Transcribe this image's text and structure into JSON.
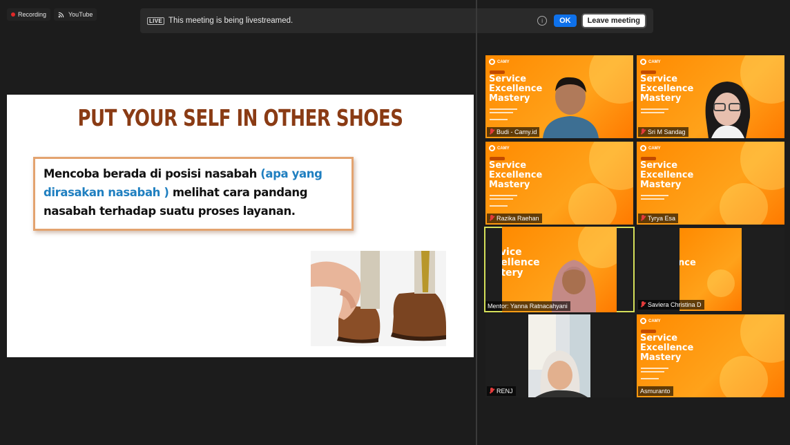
{
  "topbar": {
    "recording_label": "Recording",
    "youtube_label": "YouTube",
    "live_tag": "LIVE",
    "live_message": "This meeting is being livestreamed.",
    "ok_label": "OK",
    "leave_label": "Leave meeting"
  },
  "slide": {
    "title": "PUT YOUR SELF IN OTHER SHOES",
    "text_part1": "Mencoba berada di posisi nasabah ",
    "text_highlight": "(apa yang dirasakan nasabah )",
    "text_part2": " melihat cara pandang nasabah terhadap suatu proses layanan."
  },
  "promo": {
    "logo": "CAMY",
    "title_line1": "Service",
    "title_line2": "Excellence",
    "title_line3": "Mastery"
  },
  "participants": [
    {
      "name": "Budi - Camy.id",
      "muted": true
    },
    {
      "name": "Sri M Sandag",
      "muted": true
    },
    {
      "name": "Razika Raehan",
      "muted": true
    },
    {
      "name": "Tyrya Esa",
      "muted": true
    },
    {
      "name": "Mentor: Yanna Ratnacahyani",
      "muted": false
    },
    {
      "name": "Saviera Christina D",
      "muted": true
    },
    {
      "name": "RENJ",
      "muted": true
    },
    {
      "name": "Asmuranto",
      "muted": false
    }
  ],
  "colors": {
    "promo_orange": "#ff8a00",
    "active_speaker": "#d5e05a",
    "ok_blue": "#0e71eb",
    "slide_title": "#8a3b14",
    "slide_highlight": "#1f7fc0"
  }
}
